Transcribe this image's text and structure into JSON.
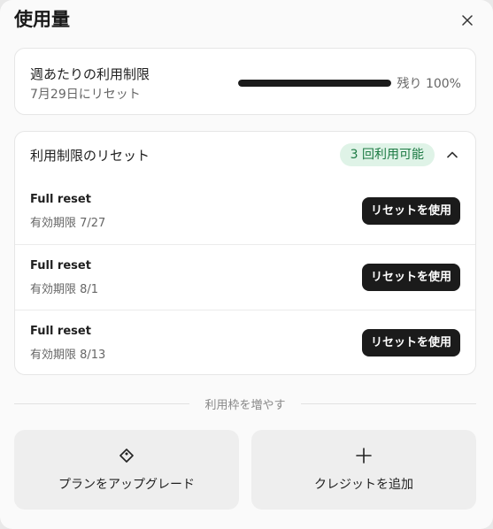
{
  "dialog": {
    "title": "使用量",
    "close_icon": "close-icon"
  },
  "weekly": {
    "label": "週あたりの利用制限",
    "reset_text": "7月29日にリセット",
    "progress_fraction": 1.0,
    "remaining_text": "残り 100%"
  },
  "reset_section": {
    "title": "利用制限のリセット",
    "badge": "3 回利用可能",
    "badge_colors": {
      "bg": "#dff3e7",
      "fg": "#1c7a43"
    },
    "items": [
      {
        "name": "Full reset",
        "expiry": "有効期限 7/27",
        "button": "リセットを使用"
      },
      {
        "name": "Full reset",
        "expiry": "有効期限 8/1",
        "button": "リセットを使用"
      },
      {
        "name": "Full reset",
        "expiry": "有効期限 8/13",
        "button": "リセットを使用"
      }
    ]
  },
  "increase": {
    "divider_label": "利用枠を増やす",
    "upgrade_label": "プランをアップグレード",
    "upgrade_icon": "tag-icon",
    "credit_label": "クレジットを追加",
    "credit_icon": "plus-icon"
  }
}
